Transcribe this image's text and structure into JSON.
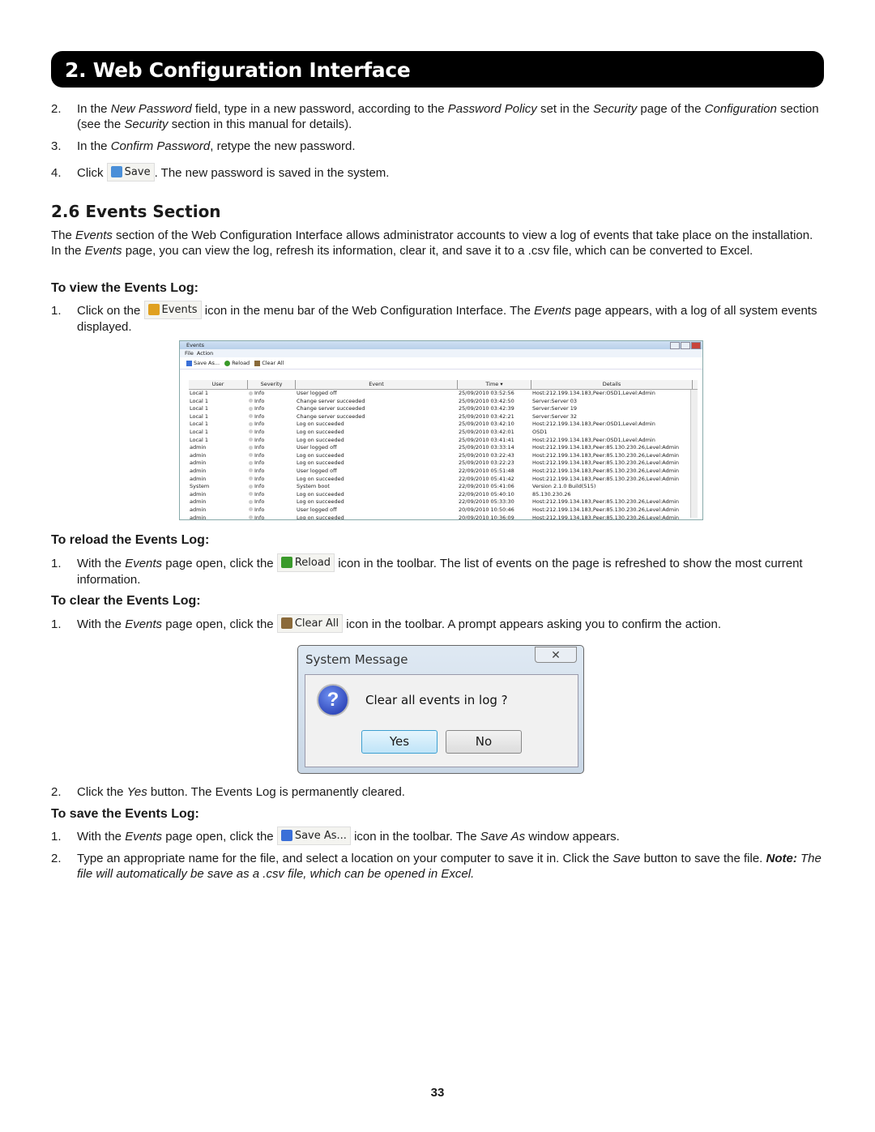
{
  "header": {
    "title": "2. Web Configuration Interface"
  },
  "top_steps": [
    {
      "num": "2.",
      "runs": [
        {
          "t": "In the "
        },
        {
          "t": "New Password",
          "i": true
        },
        {
          "t": " field, type in a new password, according to the "
        },
        {
          "t": "Password Policy",
          "i": true
        },
        {
          "t": " set in the "
        },
        {
          "t": "Security",
          "i": true
        },
        {
          "t": " page of the "
        },
        {
          "t": "Configuration",
          "i": true
        },
        {
          "t": " section (see the "
        },
        {
          "t": "Security",
          "i": true
        },
        {
          "t": " section in this manual for details)."
        }
      ]
    },
    {
      "num": "3.",
      "runs": [
        {
          "t": "In the "
        },
        {
          "t": "Confirm Password",
          "i": true
        },
        {
          "t": ", retype the new password."
        }
      ]
    },
    {
      "num": "4.",
      "runs": [
        {
          "t": "Click "
        },
        {
          "icon": "save-icon",
          "t": "Save",
          "color": "#4a8fd8"
        },
        {
          "t": ". The new password is saved in the system."
        }
      ]
    }
  ],
  "events_section": {
    "title": "2.6 Events Section",
    "intro": [
      {
        "t": "The "
      },
      {
        "t": "Events",
        "i": true
      },
      {
        "t": " section of the Web Configuration Interface allows administrator accounts to view a log of events that take place on the installation. In the "
      },
      {
        "t": "Events",
        "i": true
      },
      {
        "t": " page, you can view the log, refresh its information, clear it, and save it to a .csv file, which can be converted to Excel."
      }
    ]
  },
  "view": {
    "title": "To view the Events Log:",
    "steps": [
      {
        "num": "1.",
        "runs": [
          {
            "t": "Click on the "
          },
          {
            "icon": "events-icon",
            "t": "Events",
            "color": "#e0a020"
          },
          {
            "t": " icon in the menu bar of the Web Configuration Interface. The "
          },
          {
            "t": "Events",
            "i": true
          },
          {
            "t": " page appears, with a log of all system events displayed."
          }
        ]
      }
    ]
  },
  "events_window": {
    "title": "Events",
    "menu": [
      "File",
      "Action"
    ],
    "toolbar": [
      "Save As...",
      "Reload",
      "Clear All"
    ],
    "columns": [
      "User",
      "Severity",
      "Event",
      "Time ▾",
      "Details"
    ],
    "rows": [
      [
        "Local 1",
        "Info",
        "User logged off",
        "25/09/2010 03:52:56",
        "Host:212.199.134.183,Peer:OSD1,Level:Admin"
      ],
      [
        "Local 1",
        "Info",
        "Change server succeeded",
        "25/09/2010 03:42:50",
        "Server:Server 03"
      ],
      [
        "Local 1",
        "Info",
        "Change server succeeded",
        "25/09/2010 03:42:39",
        "Server:Server 19"
      ],
      [
        "Local 1",
        "Info",
        "Change server succeeded",
        "25/09/2010 03:42:21",
        "Server:Server 32"
      ],
      [
        "Local 1",
        "Info",
        "Log on succeeded",
        "25/09/2010 03:42:10",
        "Host:212.199.134.183,Peer:OSD1,Level:Admin"
      ],
      [
        "Local 1",
        "Info",
        "Log on succeeded",
        "25/09/2010 03:42:01",
        "OSD1"
      ],
      [
        "Local 1",
        "Info",
        "Log on succeeded",
        "25/09/2010 03:41:41",
        "Host:212.199.134.183,Peer:OSD1,Level:Admin"
      ],
      [
        "admin",
        "Info",
        "User logged off",
        "25/09/2010 03:33:14",
        "Host:212.199.134.183,Peer:85.130.230.26,Level:Admin"
      ],
      [
        "admin",
        "Info",
        "Log on succeeded",
        "25/09/2010 03:22:43",
        "Host:212.199.134.183,Peer:85.130.230.26,Level:Admin"
      ],
      [
        "admin",
        "Info",
        "Log on succeeded",
        "25/09/2010 03:22:23",
        "Host:212.199.134.183,Peer:85.130.230.26,Level:Admin"
      ],
      [
        "admin",
        "Info",
        "User logged off",
        "22/09/2010 05:51:48",
        "Host:212.199.134.183,Peer:85.130.230.26,Level:Admin"
      ],
      [
        "admin",
        "Info",
        "Log on succeeded",
        "22/09/2010 05:41:42",
        "Host:212.199.134.183,Peer:85.130.230.26,Level:Admin"
      ],
      [
        "System",
        "Info",
        "System boot",
        "22/09/2010 05:41:06",
        "Version 2.1.0 Build(515)"
      ],
      [
        "admin",
        "Info",
        "Log on succeeded",
        "22/09/2010 05:40:10",
        "85.130.230.26"
      ],
      [
        "admin",
        "Info",
        "Log on succeeded",
        "22/09/2010 05:33:30",
        "Host:212.199.134.183,Peer:85.130.230.26,Level:Admin"
      ],
      [
        "admin",
        "Info",
        "User logged off",
        "20/09/2010 10:50:46",
        "Host:212.199.134.183,Peer:85.130.230.26,Level:Admin"
      ],
      [
        "admin",
        "Info",
        "Log on succeeded",
        "20/09/2010 10:36:09",
        "Host:212.199.134.183,Peer:85.130.230.26,Level:Admin"
      ]
    ]
  },
  "reload": {
    "title": "To reload the Events Log:",
    "steps": [
      {
        "num": "1.",
        "runs": [
          {
            "t": "With the "
          },
          {
            "t": "Events",
            "i": true
          },
          {
            "t": " page open, click the "
          },
          {
            "icon": "reload-icon",
            "t": "Reload",
            "color": "#3a9a2a"
          },
          {
            "t": " icon in the toolbar. The list of events on the page is refreshed to show the most current information."
          }
        ]
      }
    ]
  },
  "clear": {
    "title": "To clear the Events Log:",
    "steps": [
      {
        "num": "1.",
        "runs": [
          {
            "t": "With the "
          },
          {
            "t": "Events",
            "i": true
          },
          {
            "t": " page open, click the "
          },
          {
            "icon": "clear-all-icon",
            "t": "Clear All",
            "color": "#8a6a3a"
          },
          {
            "t": " icon in the toolbar. A prompt appears asking you to confirm the action."
          }
        ]
      },
      {
        "num": "2.",
        "runs": [
          {
            "t": "Click the "
          },
          {
            "t": "Yes",
            "i": true
          },
          {
            "t": " button. The Events Log is permanently cleared."
          }
        ]
      }
    ]
  },
  "dialog": {
    "title": "System Message",
    "close": "✕",
    "message": "Clear all events in log ?",
    "yes": "Yes",
    "no": "No",
    "icon": "question-icon"
  },
  "save": {
    "title": "To save the Events Log:",
    "steps": [
      {
        "num": "1.",
        "runs": [
          {
            "t": "With the "
          },
          {
            "t": "Events",
            "i": true
          },
          {
            "t": " page open, click the "
          },
          {
            "icon": "save-as-icon",
            "t": "Save As...",
            "color": "#3a6fd8"
          },
          {
            "t": " icon in the toolbar. The "
          },
          {
            "t": "Save As",
            "i": true
          },
          {
            "t": " window appears."
          }
        ]
      },
      {
        "num": "2.",
        "runs": [
          {
            "t": "Type an appropriate name for the file, and select a location on your computer to save it in. Click the "
          },
          {
            "t": "Save",
            "i": true
          },
          {
            "t": " button to save the file. "
          },
          {
            "t": "Note:",
            "i": true,
            "b": true
          },
          {
            "t": " The file will automatically be save as a .csv file, which can be opened in Excel.",
            "i": true
          }
        ]
      }
    ]
  },
  "page_number": "33"
}
